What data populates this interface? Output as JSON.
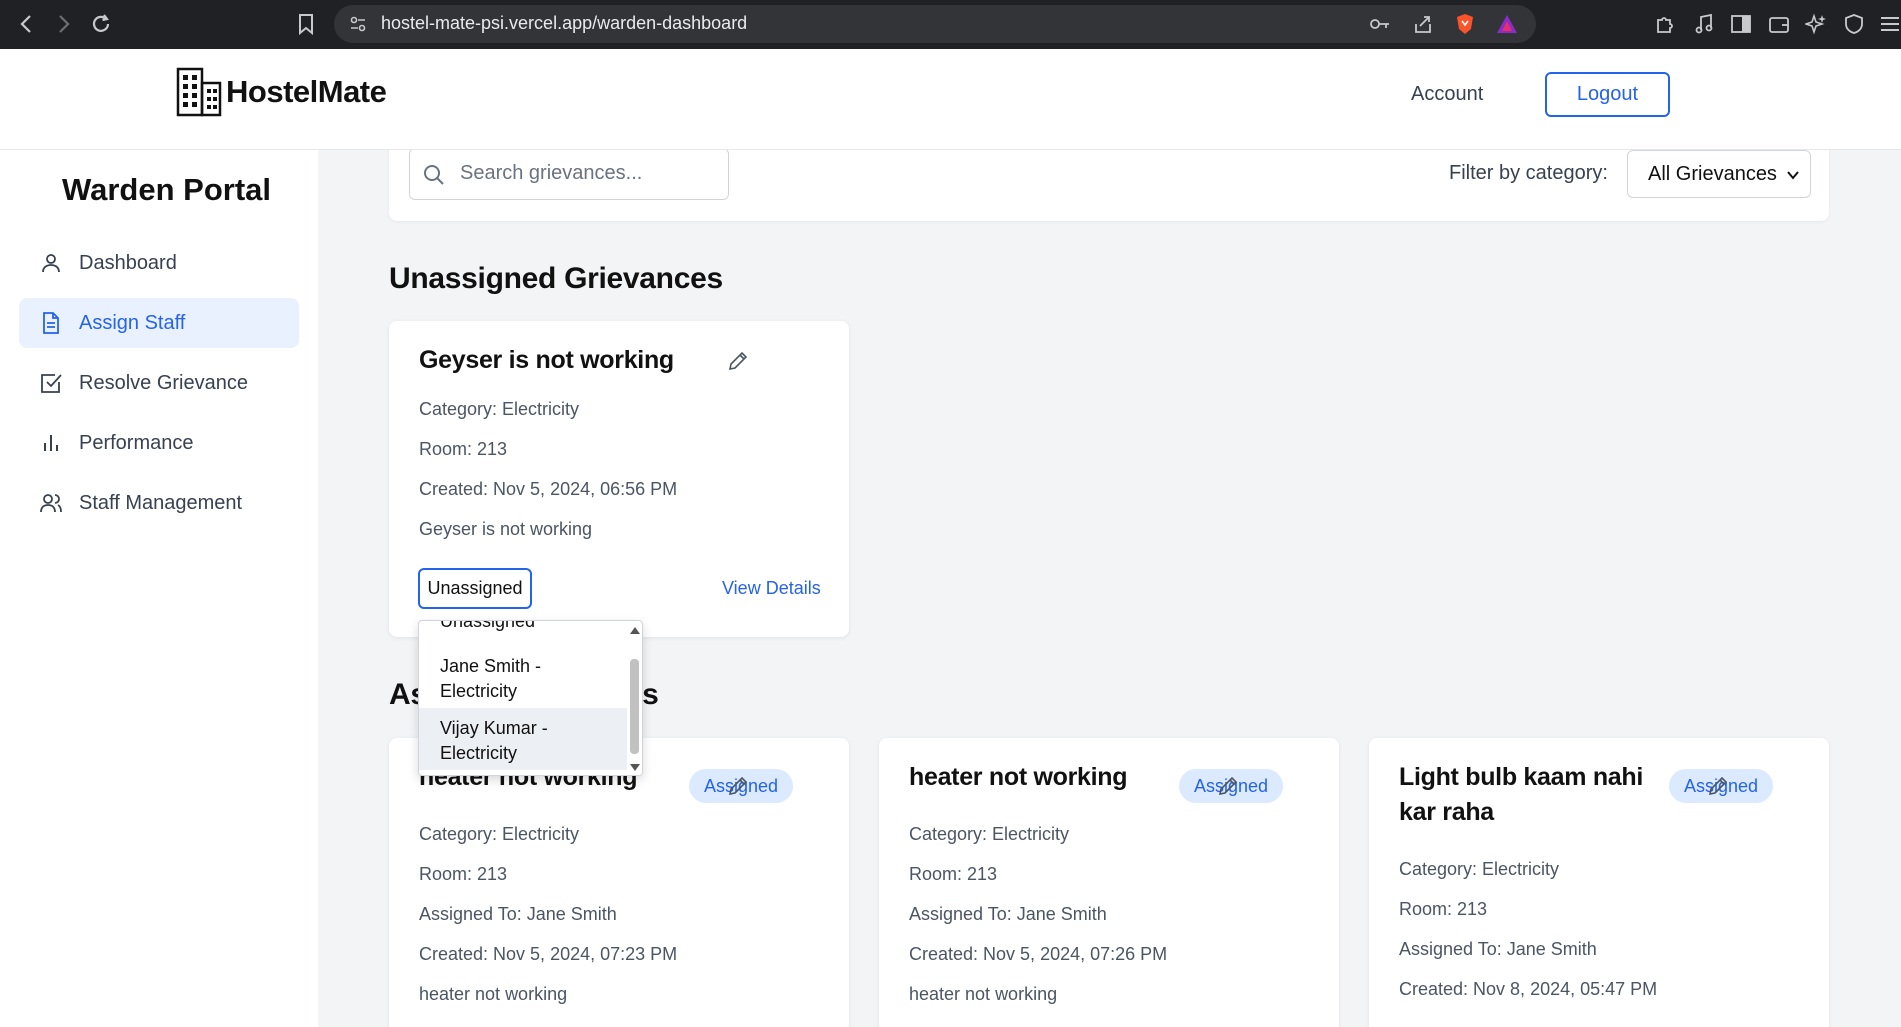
{
  "browser": {
    "url": "hostel-mate-psi.vercel.app/warden-dashboard"
  },
  "header": {
    "logo_text": "HostelMate",
    "account": "Account",
    "logout": "Logout"
  },
  "sidebar": {
    "title": "Warden Portal",
    "items": [
      {
        "label": "Dashboard",
        "icon": "user-icon"
      },
      {
        "label": "Assign Staff",
        "icon": "document-icon",
        "active": true
      },
      {
        "label": "Resolve Grievance",
        "icon": "checkbox-icon"
      },
      {
        "label": "Performance",
        "icon": "bar-chart-icon"
      },
      {
        "label": "Staff Management",
        "icon": "users-icon"
      }
    ]
  },
  "filter": {
    "search_placeholder": "Search grievances...",
    "label": "Filter by category:",
    "selected": "All Grievances"
  },
  "unassigned": {
    "title": "Unassigned Grievances",
    "card": {
      "title": "Geyser is not working",
      "category": "Category: Electricity",
      "room": "Room: 213",
      "created": "Created: Nov 5, 2024, 06:56 PM",
      "description": "Geyser is not working",
      "assign_value": "Unassigned",
      "view_details": "View Details"
    },
    "dropdown": {
      "options": [
        "Unassigned",
        "Jane Smith - Electricity",
        "Vijay Kumar - Electricity"
      ],
      "highlighted": "Vijay Kumar - Electricity"
    }
  },
  "assigned": {
    "title_visible": "As",
    "title_tail": "es",
    "cards": [
      {
        "title": "heater not working",
        "badge": "Assigned",
        "category": "Category: Electricity",
        "room": "Room: 213",
        "assigned_to": "Assigned To: Jane Smith",
        "created": "Created: Nov 5, 2024, 07:23 PM",
        "description": "heater not working"
      },
      {
        "title": "heater not working",
        "badge": "Assigned",
        "category": "Category: Electricity",
        "room": "Room: 213",
        "assigned_to": "Assigned To: Jane Smith",
        "created": "Created: Nov 5, 2024, 07:26 PM",
        "description": "heater not working"
      },
      {
        "title": "Light bulb kaam nahi kar raha",
        "badge": "Assigned",
        "category": "Category: Electricity",
        "room": "Room: 213",
        "assigned_to": "Assigned To: Jane Smith",
        "created": "Created: Nov 8, 2024, 05:47 PM"
      }
    ]
  },
  "colors": {
    "accent": "#2563eb",
    "badge_bg": "#dbeafe",
    "main_bg": "#f3f4f6",
    "active_nav_bg": "#eaf1fe"
  }
}
